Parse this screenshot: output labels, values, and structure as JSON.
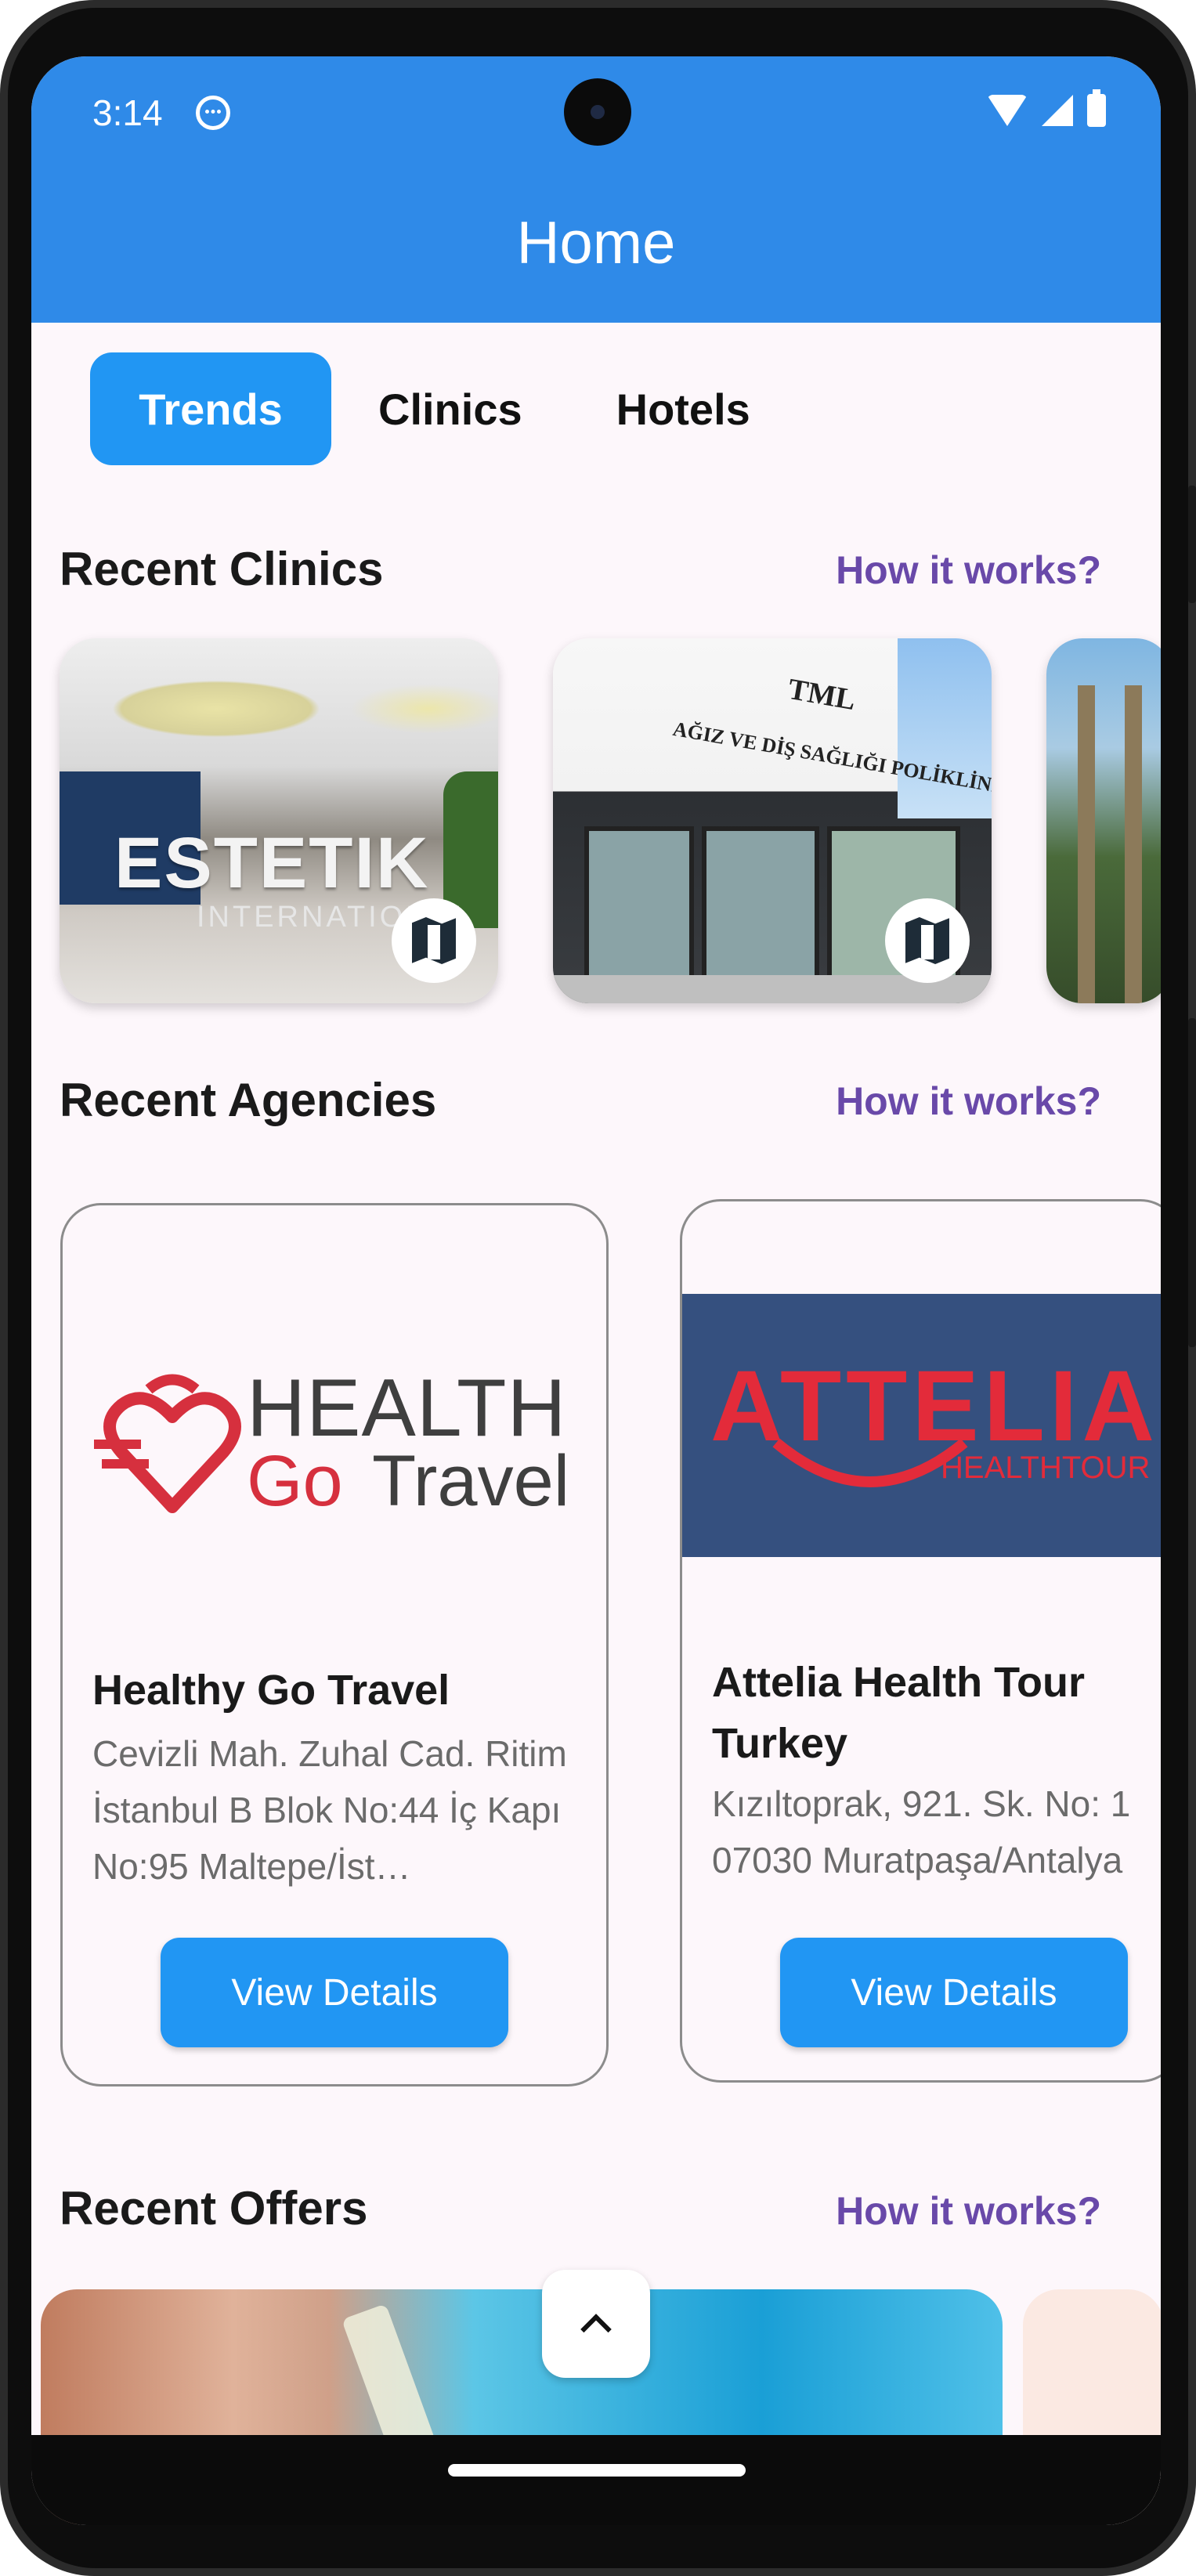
{
  "status_bar": {
    "time": "3:14"
  },
  "app_bar": {
    "title": "Home"
  },
  "tabs": [
    {
      "label": "Trends",
      "active": true
    },
    {
      "label": "Clinics",
      "active": false
    },
    {
      "label": "Hotels",
      "active": false
    }
  ],
  "recent_clinics": {
    "title": "Recent Clinics",
    "link": "How it works?",
    "cards": [
      {
        "image_text": "ESTETIK",
        "image_subtext": "INTERNATIONAL"
      },
      {
        "image_text": "TML",
        "image_subtext": "AĞIZ VE DİŞ SAĞLIĞI POLİKLİNİĞİ"
      },
      {}
    ]
  },
  "recent_agencies": {
    "title": "Recent Agencies",
    "link": "How it works?",
    "agencies": [
      {
        "logo_line1": "HEALTH",
        "logo_go": "Go",
        "logo_travel": "Travel",
        "name": "Healthy Go Travel",
        "address": "Cevizli Mah. Zuhal Cad. Ritim İstanbul B Blok No:44 İç Kapı No:95 Maltepe/İst…",
        "button": "View Details"
      },
      {
        "logo_line1": "ATTELIA",
        "logo_line2": "HEALTHTOUR",
        "name": "Attelia Health Tour Turkey",
        "address_line1": "Kızıltoprak, 921. Sk. No: 1",
        "address_line2": "07030 Muratpaşa/Antalya",
        "button": "View Details"
      }
    ]
  },
  "recent_offers": {
    "title": "Recent Offers",
    "link": "How it works?"
  },
  "colors": {
    "app_bar": "#2f8ae8",
    "primary": "#2196f3",
    "link": "#6949a9",
    "background": "#fdf7fb"
  },
  "icons": {
    "map": "map-icon",
    "scroll_top": "chevron-up-icon",
    "status": "face-icon"
  }
}
